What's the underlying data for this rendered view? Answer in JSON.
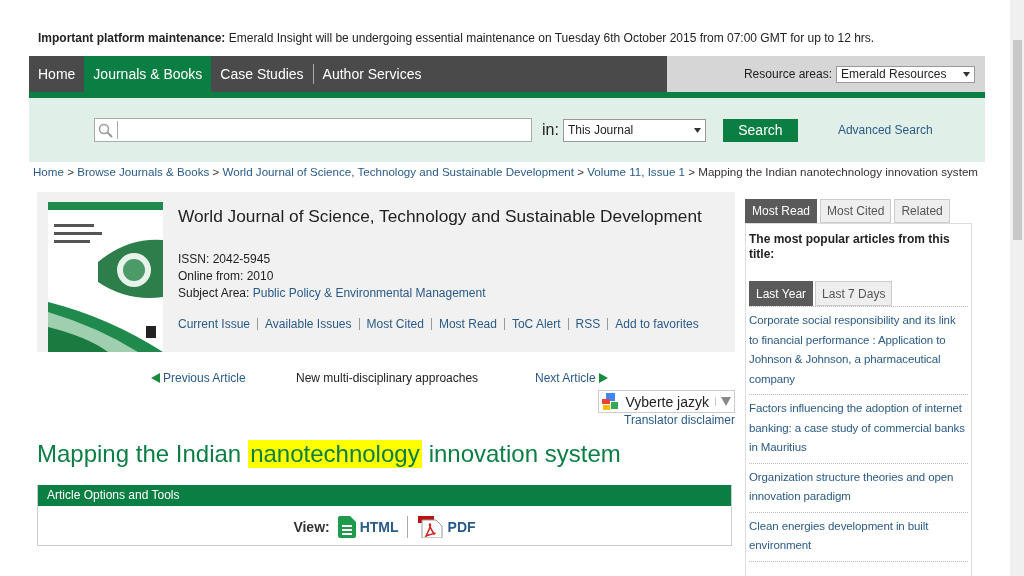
{
  "notice": {
    "label": "Important platform maintenance:",
    "text": "Emerald Insight will be undergoing essential maintenance on Tuesday 6th October 2015 from 07:00 GMT for up to 12 hrs."
  },
  "nav": {
    "items": [
      {
        "label": "Home",
        "selected": false
      },
      {
        "label": "Journals & Books",
        "selected": true
      },
      {
        "label": "Case Studies",
        "selected": false
      },
      {
        "label": "Author Services",
        "selected": false
      }
    ],
    "resource_label": "Resource areas:",
    "resource_value": "Emerald Resources"
  },
  "search": {
    "in_label": "in:",
    "scope": "This Journal",
    "button": "Search",
    "advanced": "Advanced Search"
  },
  "breadcrumb": {
    "separator": ">",
    "links": [
      "Home",
      "Browse Journals & Books",
      "World Journal of Science, Technology and Sustainable Development",
      "Volume 11, Issue 1"
    ],
    "current": "Mapping the Indian nanotechnology innovation system"
  },
  "journal": {
    "title": "World Journal of Science, Technology and Sustainable Development",
    "issn": "ISSN: 2042-5945",
    "online": "Online from: 2010",
    "subject_label": "Subject Area:",
    "subject": "Public Policy & Environmental Management",
    "links": [
      "Current Issue",
      "Available Issues",
      "Most Cited",
      "Most Read",
      "ToC Alert",
      "RSS",
      "Add to favorites"
    ]
  },
  "article_nav": {
    "previous": "Previous Article",
    "section": "New multi-disciplinary approaches",
    "next": "Next Article"
  },
  "translate": {
    "value": "Vyberte jazyk",
    "disclaimer": "Translator disclaimer"
  },
  "article": {
    "title_before": "Mapping the Indian",
    "title_highlight": "nanotechnology",
    "title_after": "innovation system"
  },
  "tools": {
    "header": "Article Options and Tools",
    "view_label": "View:",
    "formats": [
      {
        "kind": "html",
        "label": "HTML"
      },
      {
        "kind": "pdf",
        "label": "PDF"
      }
    ]
  },
  "sidebar": {
    "tabs": [
      {
        "label": "Most Read",
        "selected": true
      },
      {
        "label": "Most Cited",
        "selected": false
      },
      {
        "label": "Related",
        "selected": false
      }
    ],
    "intro": "The most popular articles from this title:",
    "periods": [
      {
        "label": "Last Year",
        "selected": true
      },
      {
        "label": "Last 7 Days",
        "selected": false
      }
    ],
    "articles": [
      "Corporate social responsibility and its link to financial performance : Application to Johnson & Johnson, a pharmaceutical company",
      "Factors influencing the adoption of internet banking: a case study of commercial banks in Mauritius",
      "Organization structure theories and open innovation paradigm",
      "Clean energies development in built environment"
    ]
  }
}
